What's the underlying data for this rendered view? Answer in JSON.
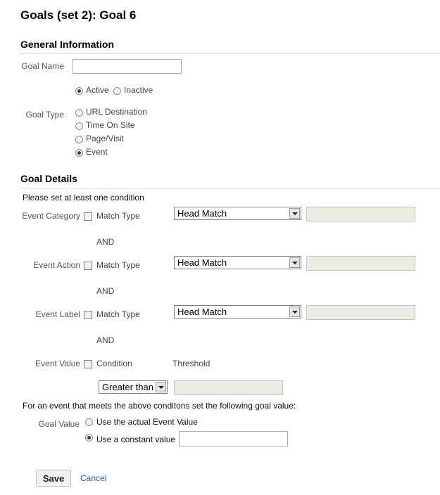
{
  "page": {
    "title": "Goals (set 2): Goal 6"
  },
  "general": {
    "section_title": "General Information",
    "goal_name_label": "Goal Name",
    "goal_name_value": "",
    "status_active": "Active",
    "status_inactive": "Inactive",
    "status_selected": "Active",
    "goal_type_label": "Goal Type",
    "types": [
      "URL Destination",
      "Time On Site",
      "Page/Visit",
      "Event"
    ],
    "type_selected": "Event"
  },
  "details": {
    "section_title": "Goal Details",
    "instruction": "Please set at least one condition",
    "match_type_label": "Match Type",
    "condition_label": "Condition",
    "threshold_label": "Threshold",
    "and_label": "AND",
    "event_category": {
      "label": "Event Category",
      "select": "Head Match",
      "value": ""
    },
    "event_action": {
      "label": "Event Action",
      "select": "Head Match",
      "value": ""
    },
    "event_label": {
      "label": "Event Label",
      "select": "Head Match",
      "value": ""
    },
    "event_value": {
      "label": "Event Value",
      "select": "Greater than",
      "value": ""
    },
    "goal_value_instruction": "For an event that meets the above conditons set the following goal value:",
    "goal_value_label": "Goal Value",
    "option_actual": "Use the actual Event Value",
    "option_constant": "Use a constant value",
    "option_selected": "Use a constant value",
    "constant_value": ""
  },
  "actions": {
    "save_label": "Save",
    "cancel_label": "Cancel"
  }
}
